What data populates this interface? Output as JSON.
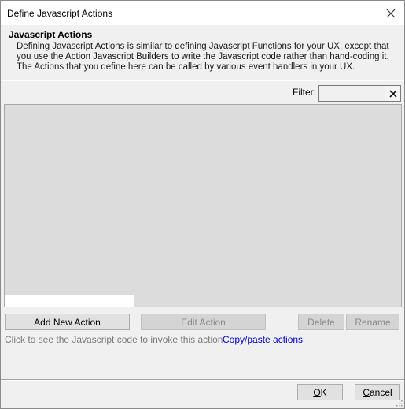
{
  "window": {
    "title": "Define Javascript Actions"
  },
  "header": {
    "title": "Javascript Actions",
    "description": "Defining Javascript Actions is similar to defining Javascript Functions for your UX, except that you use the Action Javascript Builders to write the Javascript code rather than hand-coding it. The Actions that you define here can be called by various event handlers in your UX."
  },
  "filter": {
    "label": "Filter:",
    "value": ""
  },
  "actions_list": {
    "items": []
  },
  "buttons": {
    "add_new_action": "Add New Action",
    "edit_action": "Edit Action",
    "delete": "Delete",
    "rename": "Rename"
  },
  "links": {
    "see_js_code": "Click to see the Javascript code to invoke this action",
    "copy_paste": "Copy/paste actions"
  },
  "footer": {
    "ok_rest": "K",
    "ok_mnemonic": "O",
    "cancel_mnemonic": "C",
    "cancel_rest": "ancel"
  },
  "colors": {
    "window_bg": "#f0f0f0",
    "list_bg": "#dcdcdc",
    "link_blue": "#0000cc",
    "disabled_text": "#8c8c8c"
  }
}
